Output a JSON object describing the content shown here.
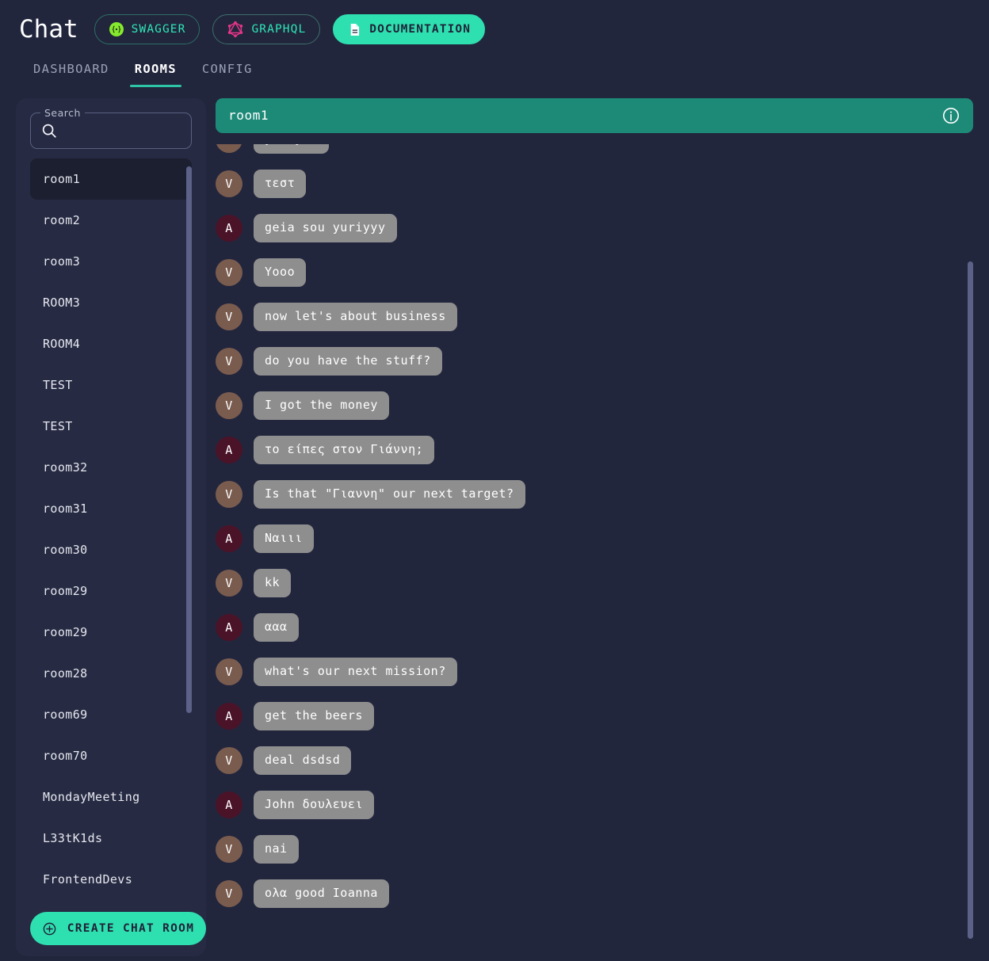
{
  "header": {
    "brand": "Chat",
    "buttons": [
      {
        "label": "SWAGGER",
        "icon": "swagger-icon",
        "style": "outline"
      },
      {
        "label": "GRAPHQL",
        "icon": "graphql-icon",
        "style": "outline"
      },
      {
        "label": "DOCUMENTATION",
        "icon": "document-icon",
        "style": "solid"
      }
    ]
  },
  "tabs": [
    {
      "label": "DASHBOARD",
      "active": false
    },
    {
      "label": "ROOMS",
      "active": true
    },
    {
      "label": "CONFIG",
      "active": false
    }
  ],
  "sidebar": {
    "search": {
      "legend": "Search",
      "value": "",
      "placeholder": "",
      "icon": "search-icon"
    },
    "rooms": [
      {
        "label": "room1",
        "selected": true
      },
      {
        "label": "room2",
        "selected": false
      },
      {
        "label": "room3",
        "selected": false
      },
      {
        "label": "ROOM3",
        "selected": false
      },
      {
        "label": "ROOM4",
        "selected": false
      },
      {
        "label": "TEST",
        "selected": false
      },
      {
        "label": "TEST",
        "selected": false
      },
      {
        "label": "room32",
        "selected": false
      },
      {
        "label": "room31",
        "selected": false
      },
      {
        "label": "room30",
        "selected": false
      },
      {
        "label": "room29",
        "selected": false
      },
      {
        "label": "room29",
        "selected": false
      },
      {
        "label": "room28",
        "selected": false
      },
      {
        "label": "room69",
        "selected": false
      },
      {
        "label": "room70",
        "selected": false
      },
      {
        "label": "MondayMeeting",
        "selected": false
      },
      {
        "label": "L33tK1ds",
        "selected": false
      },
      {
        "label": "FrontendDevs",
        "selected": false
      }
    ],
    "create_button": {
      "label": "CREATE CHAT ROOM",
      "icon": "plus-circle-icon"
    }
  },
  "room": {
    "title": "room1",
    "info_icon": "info-icon",
    "messages": [
      {
        "initial": "V",
        "text": "yes yes"
      },
      {
        "initial": "V",
        "text": "τεστ"
      },
      {
        "initial": "A",
        "text": "geia sou yuriyyy"
      },
      {
        "initial": "V",
        "text": "Yooo"
      },
      {
        "initial": "V",
        "text": "now let's about business"
      },
      {
        "initial": "V",
        "text": "do you have the stuff?"
      },
      {
        "initial": "V",
        "text": "I got the money"
      },
      {
        "initial": "A",
        "text": "το είπες στον Γιάννη;"
      },
      {
        "initial": "V",
        "text": "Is that \"Γιαννη\" our next target?"
      },
      {
        "initial": "A",
        "text": "Ναιιι"
      },
      {
        "initial": "V",
        "text": "kk"
      },
      {
        "initial": "A",
        "text": "ααα"
      },
      {
        "initial": "V",
        "text": "what's our next mission?"
      },
      {
        "initial": "A",
        "text": "get the beers"
      },
      {
        "initial": "V",
        "text": "deal dsdsd"
      },
      {
        "initial": "A",
        "text": "John δουλευει"
      },
      {
        "initial": "V",
        "text": "nai"
      },
      {
        "initial": "V",
        "text": "ολα good Ioanna"
      }
    ]
  },
  "colors": {
    "page_background": "#22263d",
    "panel_background": "#262a42",
    "accent_teal": "#2ee0b0",
    "room_header_teal": "#1d8a78",
    "graphql_pink": "#e53589",
    "swagger_green": "#85ea2d",
    "bubble_gray": "#8e8e8e",
    "avatar_v": "#7a5c4f",
    "avatar_a": "#4a1328",
    "selected_room": "#1c1f30",
    "scrollbar_thumb": "#5c6188"
  }
}
